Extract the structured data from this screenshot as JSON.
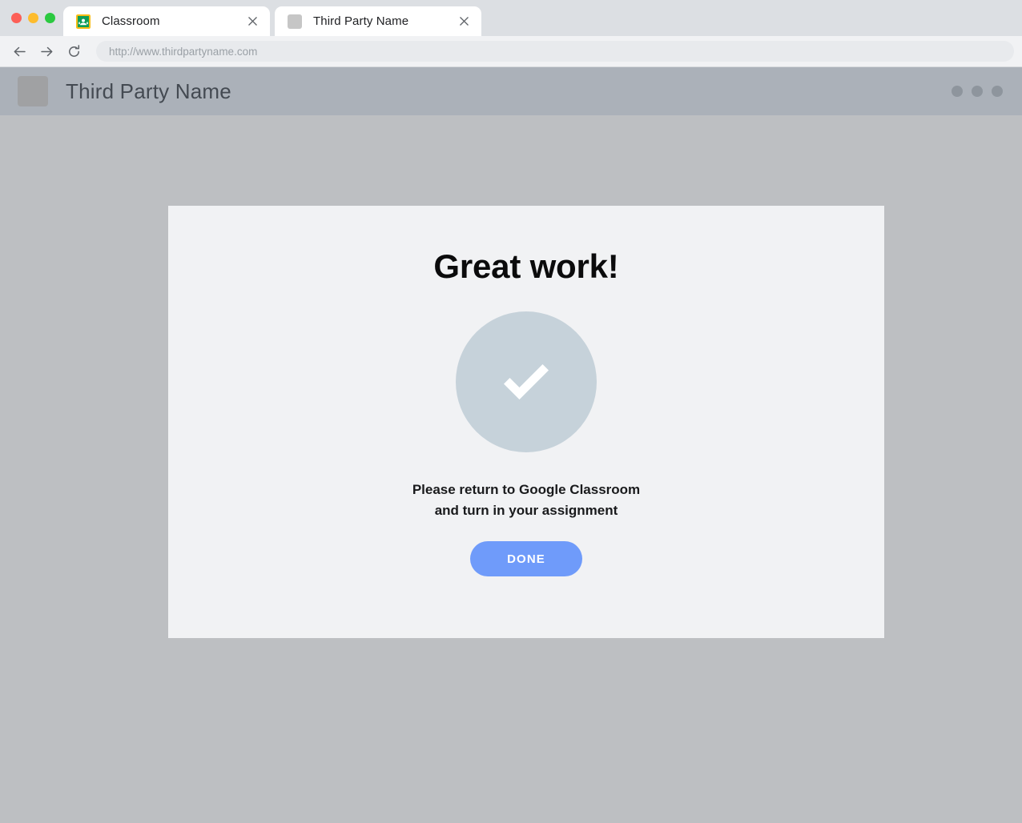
{
  "browser": {
    "traffic_lights": [
      {
        "name": "close",
        "color": "#fc5f57"
      },
      {
        "name": "minimize",
        "color": "#fdbc2d"
      },
      {
        "name": "maximize",
        "color": "#2bc940"
      }
    ],
    "tabs": [
      {
        "title": "Classroom",
        "favicon": "google-classroom-icon",
        "active": false
      },
      {
        "title": "Third Party Name",
        "favicon": "placeholder-square-icon",
        "active": true
      }
    ],
    "toolbar": {
      "back_icon": "back-arrow-icon",
      "forward_icon": "forward-arrow-icon",
      "reload_icon": "reload-icon",
      "address": "http://www.thirdpartyname.com"
    }
  },
  "site": {
    "header": {
      "logo_icon": "placeholder-logo-icon",
      "title": "Third Party Name",
      "dots": [
        "dot-1",
        "dot-2",
        "dot-3"
      ]
    },
    "card": {
      "heading": "Great work!",
      "success_icon": "checkmark-circle-icon",
      "message_line_1": "Please return to Google Classroom",
      "message_line_2": "and turn in your assignment",
      "button_label": "DONE"
    }
  },
  "colors": {
    "page_background": "#bdbfc2",
    "header_background": "#abb1b9",
    "card_background": "#f1f2f4",
    "check_circle": "#c6d2da",
    "button_accent": "#6f9bfa",
    "tabstrip_background": "#dcdfe3"
  }
}
